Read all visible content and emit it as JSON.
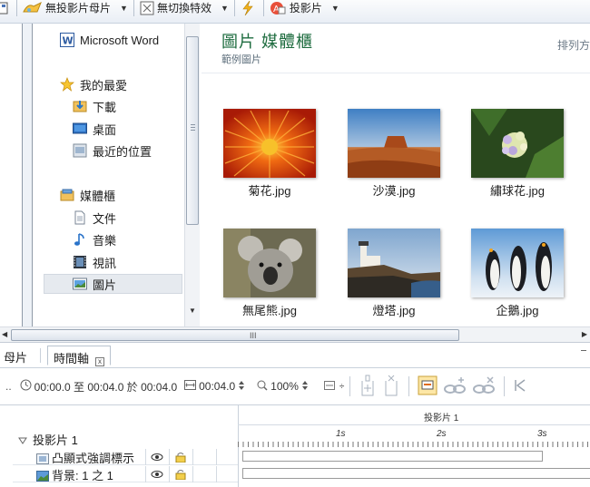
{
  "toolbar": {
    "master_label": "無投影片母片",
    "transition_label": "無切換特效",
    "slide_label": "投影片"
  },
  "nav": {
    "items": [
      {
        "label": "Microsoft Word"
      },
      {
        "label": "我的最愛"
      },
      {
        "label": "下載"
      },
      {
        "label": "桌面"
      },
      {
        "label": "最近的位置"
      },
      {
        "label": "媒體櫃"
      },
      {
        "label": "文件"
      },
      {
        "label": "音樂"
      },
      {
        "label": "視訊"
      },
      {
        "label": "圖片"
      }
    ]
  },
  "content": {
    "title": "圖片 媒體櫃",
    "subtitle": "範例圖片",
    "sort_label": "排列方",
    "images": [
      {
        "name": "菊花.jpg"
      },
      {
        "name": "沙漠.jpg"
      },
      {
        "name": "繡球花.jpg"
      },
      {
        "name": "無尾熊.jpg"
      },
      {
        "name": "燈塔.jpg"
      },
      {
        "name": "企鵝.jpg"
      }
    ]
  },
  "hscroll": {
    "grip": "III"
  },
  "tabs": {
    "tab1": "母片",
    "tab2": "時間軸",
    "close": "x"
  },
  "timeline_toolbar": {
    "leading": "..",
    "time_range": "00:00.0 至 00:04.0 於 00:04.0",
    "duration": "00:04.0",
    "zoom": "100%",
    "stepper": "÷"
  },
  "timeline": {
    "header": "投影片 1",
    "ruler": [
      "1s",
      "2s",
      "3s"
    ],
    "group_label": "投影片 1",
    "rows": [
      {
        "label": "凸顯式強調標示"
      },
      {
        "label": "背景: 1 之 1"
      }
    ]
  },
  "colors": {
    "title_green": "#1e6c3f",
    "selection": "#e6eaef"
  }
}
